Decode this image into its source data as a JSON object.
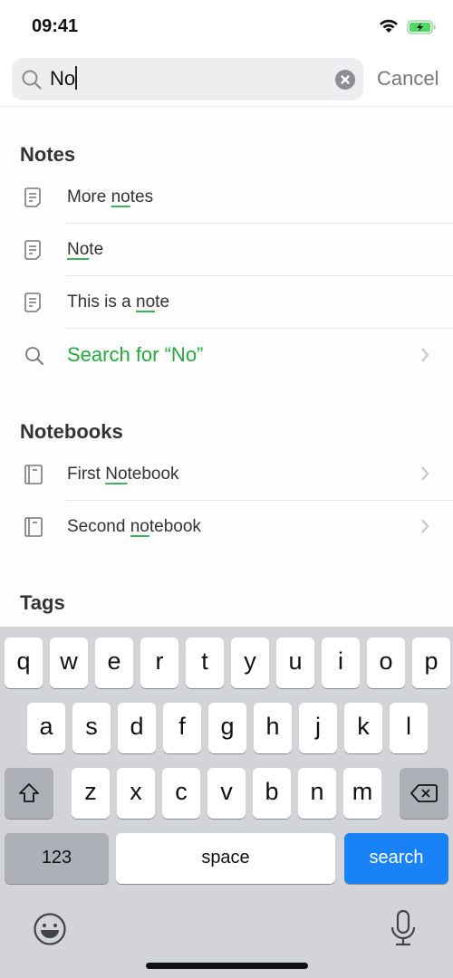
{
  "status_bar": {
    "time": "09:41",
    "battery_color": "#4cd964"
  },
  "search": {
    "query": "No",
    "cancel_label": "Cancel"
  },
  "sections": {
    "notes": {
      "title": "Notes",
      "items": [
        {
          "pre": "More ",
          "match": "no",
          "post": "tes"
        },
        {
          "pre": "",
          "match": "No",
          "post": "te"
        },
        {
          "pre": "This is a ",
          "match": "no",
          "post": "te"
        }
      ],
      "search_for": "Search for “No”"
    },
    "notebooks": {
      "title": "Notebooks",
      "items": [
        {
          "pre": "First ",
          "match": "No",
          "post": "tebook"
        },
        {
          "pre": "Second ",
          "match": "no",
          "post": "tebook"
        }
      ]
    },
    "tags": {
      "title": "Tags"
    }
  },
  "keyboard": {
    "row1": [
      "q",
      "w",
      "e",
      "r",
      "t",
      "y",
      "u",
      "i",
      "o",
      "p"
    ],
    "row2": [
      "a",
      "s",
      "d",
      "f",
      "g",
      "h",
      "j",
      "k",
      "l"
    ],
    "row3": [
      "z",
      "x",
      "c",
      "v",
      "b",
      "n",
      "m"
    ],
    "numbers_label": "123",
    "space_label": "space",
    "search_label": "search"
  },
  "colors": {
    "accent_green": "#25a93c",
    "search_key_blue": "#1a82f7"
  }
}
